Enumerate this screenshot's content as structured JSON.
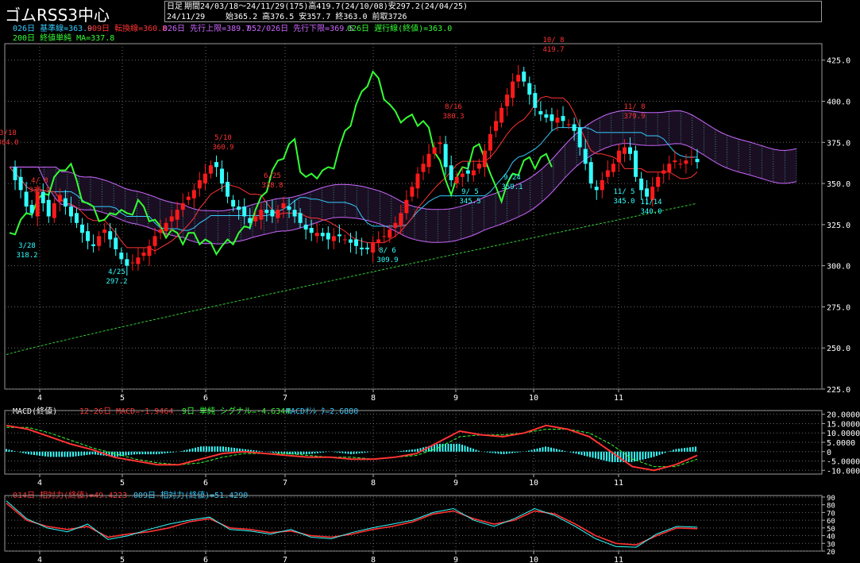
{
  "title": "ゴムRSS3中心",
  "header": {
    "line1_label": "日足",
    "line1": "期間24/03/18〜24/11/29(175)高419.7(24/10/08)安297.2(24/04/25)",
    "date": "24/11/29",
    "ohlc": "始365.2 高376.5 安357.7 終363.0 前取3726"
  },
  "legend": [
    {
      "text": "026日 基準線=363.9",
      "color": "#33ccff"
    },
    {
      "text": "009日 転換線=360.8",
      "color": "#ff3333"
    },
    {
      "text": "026日 先行上限=389.7",
      "color": "#cc66ff"
    },
    {
      "text": "052/026日 先行下限=369.5",
      "color": "#cc66ff"
    },
    {
      "text": "026日 遅行線(終値)=363.0",
      "color": "#33ff33"
    }
  ],
  "legend2": {
    "text": "200日 終値単純 MA=337.8",
    "color": "#33ff33"
  },
  "macd_legend": [
    {
      "text": "MACD(終値)",
      "color": "#ffffff"
    },
    {
      "text": "12-26日 MACD=-1.9464",
      "color": "#ff3333"
    },
    {
      "text": "9日 単純 シグナル=-4.6344",
      "color": "#33ff33"
    },
    {
      "text": "MACDｵｼﾚｰﾀ=2.6880",
      "color": "#33ccff"
    }
  ],
  "rsi_legend": [
    {
      "text": "014日 相対力(終値)=49.4223",
      "color": "#ff3333"
    },
    {
      "text": "009日 相対力(終値)=51.4290",
      "color": "#33ccff"
    }
  ],
  "colors": {
    "up": "#ff1a1a",
    "down": "#33ffff",
    "cloud": "#cc66ff",
    "lagging": "#33ff33",
    "base": "#33ccff",
    "conv": "#ff3333",
    "ma": "#33cc33",
    "text": "#ffffff",
    "grid": "#808080"
  },
  "chart_data": [
    {
      "type": "candlestick",
      "panel": "price",
      "ylim": [
        225,
        435
      ],
      "yticks": [
        "425.0",
        "400.0",
        "375.0",
        "350.0",
        "325.0",
        "300.0",
        "275.0",
        "250.0",
        "225.0"
      ],
      "xticks": [
        "4",
        "5",
        "6",
        "7",
        "8",
        "9",
        "10",
        "11"
      ],
      "close_path": [
        360,
        352,
        346,
        336,
        332,
        345,
        338,
        330,
        338,
        343,
        336,
        330,
        326,
        320,
        315,
        312,
        318,
        322,
        316,
        310,
        304,
        300,
        302,
        305,
        308,
        312,
        318,
        322,
        326,
        330,
        334,
        338,
        342,
        346,
        352,
        356,
        361,
        360,
        350,
        342,
        336,
        334,
        330,
        326,
        330,
        334,
        332,
        330,
        334,
        338,
        334,
        330,
        326,
        322,
        320,
        320,
        318,
        316,
        318,
        318,
        316,
        314,
        312,
        310,
        310,
        314,
        316,
        318,
        322,
        326,
        332,
        340,
        348,
        356,
        362,
        368,
        372,
        375,
        360,
        352,
        354,
        356,
        356,
        358,
        362,
        370,
        380,
        388,
        396,
        404,
        412,
        416,
        412,
        404,
        396,
        392,
        390,
        388,
        390,
        388,
        386,
        382,
        372,
        362,
        350,
        346,
        352,
        358,
        362,
        370,
        372,
        368,
        354,
        346,
        342,
        348,
        354,
        358,
        362,
        364,
        362,
        364,
        366,
        363
      ],
      "labels": [
        {
          "date": "3/18",
          "value": "364.0"
        },
        {
          "date": "3/28",
          "value": "318.2"
        },
        {
          "date": "4/ 8",
          "value": "335.9"
        },
        {
          "date": "4/25",
          "value": "297.2"
        },
        {
          "date": "5/10",
          "value": "360.9"
        },
        {
          "date": "6/25",
          "value": "338.8"
        },
        {
          "date": "8/ 6",
          "value": "309.9"
        },
        {
          "date": "8/16",
          "value": "380.3"
        },
        {
          "date": "9/ 5",
          "value": "345.5"
        },
        {
          "date": "9/24",
          "value": "359.1"
        },
        {
          "date": "10/ 8",
          "value": "419.7"
        },
        {
          "date": "11/ 5",
          "value": "345.0"
        },
        {
          "date": "11/ 8",
          "value": "379.9"
        },
        {
          "date": "11/14",
          "value": "340.0"
        }
      ]
    },
    {
      "type": "line",
      "panel": "macd",
      "ylim": [
        -12,
        22
      ],
      "yticks": [
        "20.0000",
        "15.0000",
        "10.0000",
        "5.0000",
        "0",
        "-5.0000",
        "-10.0000"
      ],
      "xticks": [
        "4",
        "5",
        "6",
        "7",
        "8",
        "9",
        "10",
        "11"
      ],
      "series": [
        {
          "name": "MACD",
          "values": [
            14,
            12,
            8,
            4,
            1,
            -3,
            -5,
            -7,
            -7,
            -4,
            -1,
            0,
            -1,
            -2,
            -3,
            -3,
            -4,
            -4,
            -3,
            -1,
            5,
            11,
            9,
            8,
            10,
            14,
            12,
            8,
            0,
            -8,
            -10,
            -7,
            -2
          ]
        },
        {
          "name": "シグナル",
          "values": [
            13,
            13,
            10,
            6,
            2,
            -1,
            -4,
            -6,
            -7,
            -6,
            -3,
            -1,
            -1,
            -1,
            -2,
            -3,
            -3,
            -4,
            -3,
            -2,
            2,
            8,
            9,
            9,
            10,
            12,
            12,
            10,
            4,
            -4,
            -8,
            -8,
            -4
          ]
        }
      ]
    },
    {
      "type": "line",
      "panel": "rsi",
      "ylim": [
        20,
        92
      ],
      "yticks": [
        "90",
        "80",
        "70",
        "60",
        "50",
        "40",
        "30",
        "20"
      ],
      "xticks": [
        "4",
        "5",
        "6",
        "7",
        "8",
        "9",
        "10",
        "11"
      ],
      "series": [
        {
          "name": "014日 相対力",
          "values": [
            82,
            60,
            52,
            48,
            52,
            38,
            42,
            45,
            50,
            58,
            62,
            50,
            48,
            44,
            46,
            40,
            38,
            42,
            48,
            52,
            58,
            68,
            72,
            62,
            55,
            60,
            72,
            68,
            55,
            40,
            30,
            28,
            40,
            50,
            49
          ]
        },
        {
          "name": "009日 相対力",
          "values": [
            85,
            62,
            50,
            45,
            55,
            35,
            40,
            48,
            55,
            60,
            64,
            48,
            46,
            42,
            48,
            38,
            36,
            44,
            50,
            55,
            60,
            70,
            75,
            60,
            52,
            62,
            75,
            66,
            52,
            36,
            26,
            25,
            42,
            52,
            51
          ]
        }
      ]
    }
  ]
}
